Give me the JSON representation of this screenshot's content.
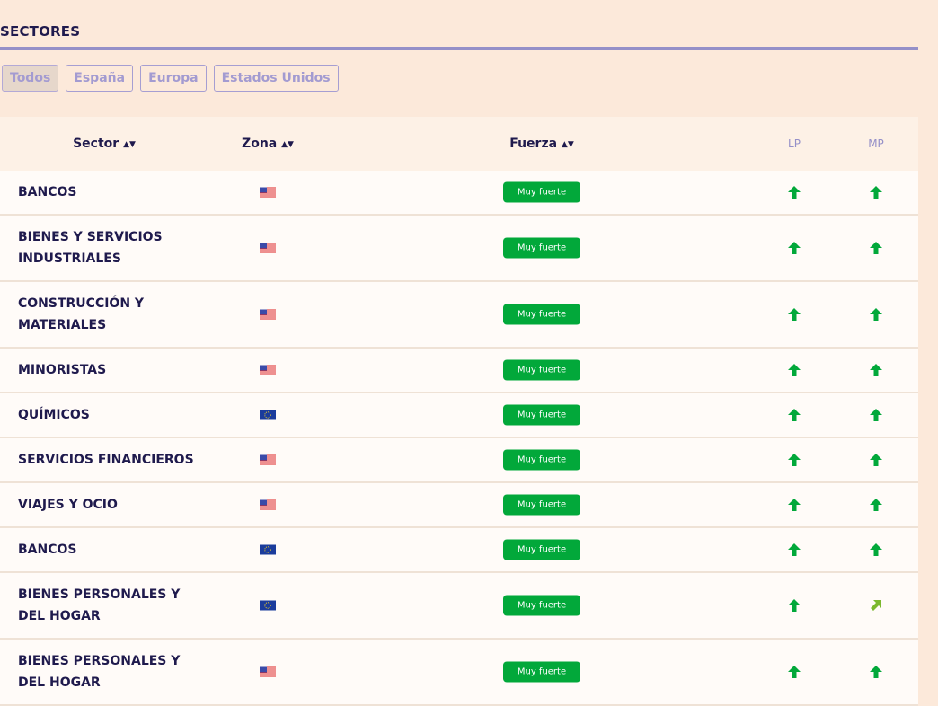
{
  "title": "SECTORES",
  "filters": [
    {
      "label": "Todos",
      "active": true
    },
    {
      "label": "España"
    },
    {
      "label": "Europa"
    },
    {
      "label": "Estados Unidos"
    }
  ],
  "headers": {
    "sector": "Sector",
    "zona": "Zona",
    "fuerza": "Fuerza",
    "lp": "LP",
    "mp": "MP"
  },
  "colors": {
    "green": "#02a83a",
    "light_green": "#7cb82f"
  },
  "rows": [
    {
      "sector": "BANCOS",
      "zona": "us-flag",
      "fuerza": "Muy fuerte",
      "lp": "up",
      "mp": "up"
    },
    {
      "sector": "BIENES Y SERVICIOS INDUSTRIALES",
      "zona": "us-flag",
      "fuerza": "Muy fuerte",
      "lp": "up",
      "mp": "up"
    },
    {
      "sector": "CONSTRUCCIÓN Y MATERIALES",
      "zona": "us-flag",
      "fuerza": "Muy fuerte",
      "lp": "up",
      "mp": "up"
    },
    {
      "sector": "MINORISTAS",
      "zona": "us-flag",
      "fuerza": "Muy fuerte",
      "lp": "up",
      "mp": "up"
    },
    {
      "sector": "QUÍMICOS",
      "zona": "eu-flag",
      "fuerza": "Muy fuerte",
      "lp": "up",
      "mp": "up"
    },
    {
      "sector": "SERVICIOS FINANCIEROS",
      "zona": "us-flag",
      "fuerza": "Muy fuerte",
      "lp": "up",
      "mp": "up"
    },
    {
      "sector": "VIAJES Y OCIO",
      "zona": "us-flag",
      "fuerza": "Muy fuerte",
      "lp": "up",
      "mp": "up"
    },
    {
      "sector": "BANCOS",
      "zona": "eu-flag",
      "fuerza": "Muy fuerte",
      "lp": "up",
      "mp": "up"
    },
    {
      "sector": "BIENES PERSONALES Y DEL HOGAR",
      "zona": "eu-flag",
      "fuerza": "Muy fuerte",
      "lp": "up",
      "mp": "up-right"
    },
    {
      "sector": "BIENES PERSONALES Y DEL HOGAR",
      "zona": "us-flag",
      "fuerza": "Muy fuerte",
      "lp": "up",
      "mp": "up"
    }
  ]
}
